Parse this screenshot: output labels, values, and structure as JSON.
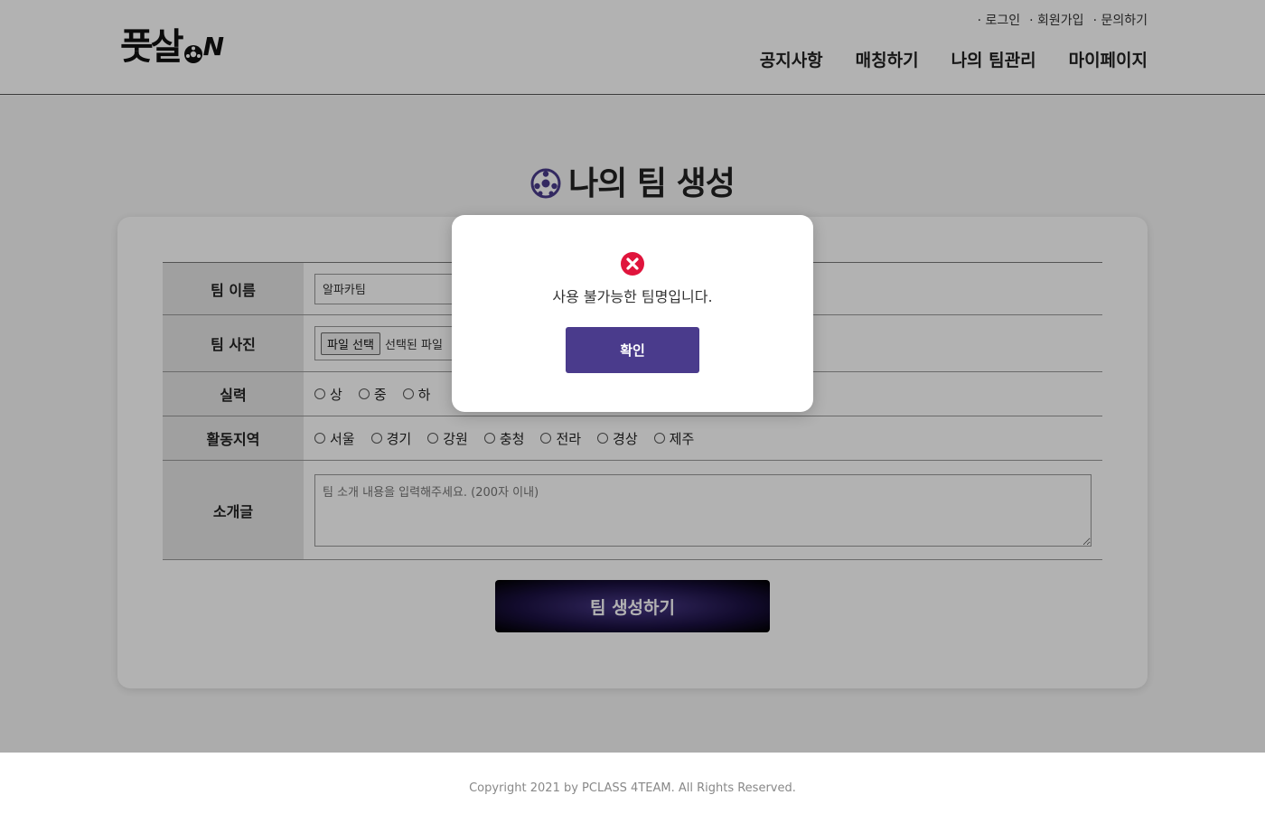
{
  "header": {
    "logo_text": "풋살",
    "logo_suffix": "N",
    "util_links": [
      "로그인",
      "회원가입",
      "문의하기"
    ],
    "nav": [
      "공지사항",
      "매칭하기",
      "나의 팀관리",
      "마이페이지"
    ]
  },
  "main": {
    "title": "나의 팀 생성",
    "form": {
      "team_name_label": "팀 이름",
      "team_name_value": "알파카팀",
      "team_photo_label": "팀 사진",
      "file_button": "파일 선택",
      "file_status": "선택된 파일",
      "skill_label": "실력",
      "skill_options": [
        "상",
        "중",
        "하"
      ],
      "region_label": "활동지역",
      "region_options": [
        "서울",
        "경기",
        "강원",
        "충청",
        "전라",
        "경상",
        "제주"
      ],
      "intro_label": "소개글",
      "intro_placeholder": "팀 소개 내용을 입력해주세요. (200자 이내)"
    },
    "submit_label": "팀 생성하기"
  },
  "footer": {
    "copyright": "Copyright 2021 by PCLASS 4TEAM. All Rights Reserved."
  },
  "modal": {
    "icon": "error-x-icon",
    "message": "사용 불가능한 팀명입니다.",
    "confirm_label": "확인"
  },
  "colors": {
    "accent": "#4a3b8c",
    "error": "#e0143c"
  }
}
